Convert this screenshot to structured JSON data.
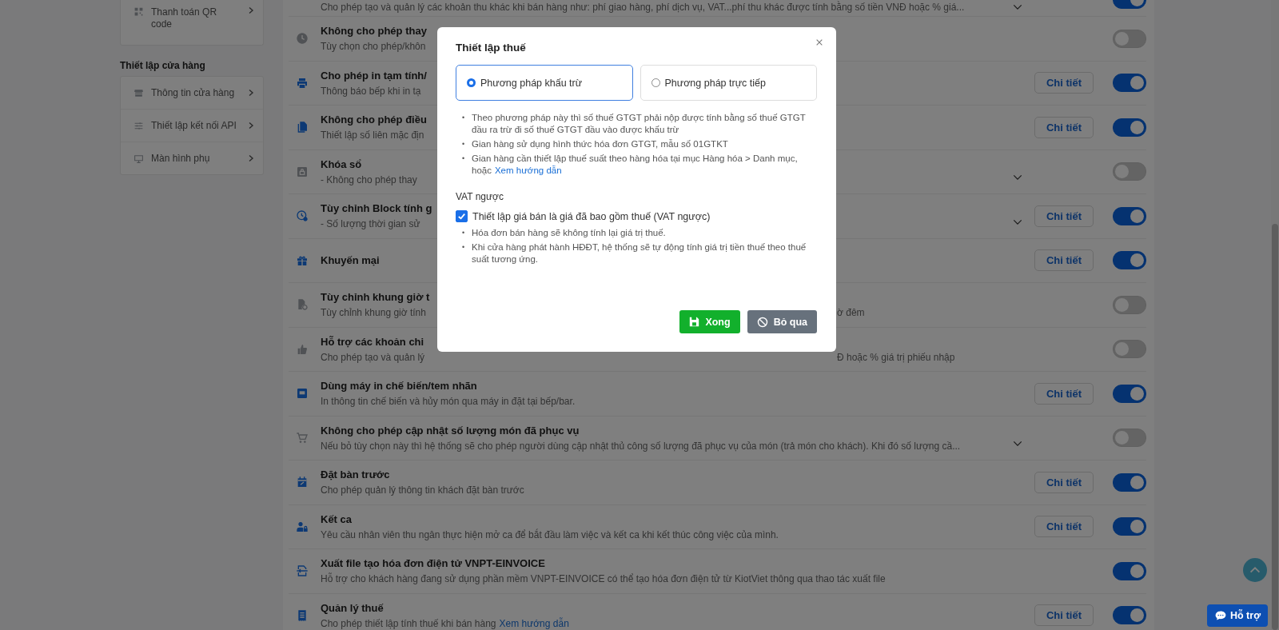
{
  "sidebar": {
    "cards": [
      {
        "items": [
          {
            "label": "Thanh toán QR code"
          }
        ]
      },
      {
        "heading": "Thiết lập cửa hàng",
        "items": [
          {
            "label": "Thông tin cửa hàng"
          },
          {
            "label": "Thiết lập kết nối API"
          },
          {
            "label": "Màn hình phụ"
          }
        ]
      }
    ]
  },
  "settings": [
    {
      "desc": "Cho phép tạo và quản lý các khoản thu khác khi bán hàng như: phí giao hàng, phí dịch vụ, VAT...phí thu khác được tính bằng số tiền VNĐ hoặc % giá...",
      "has_more": true,
      "on": true
    },
    {
      "title": "Không cho phép thay",
      "desc": "Tùy chọn cho phép/khôn",
      "on": false
    },
    {
      "title": "Cho phép in tạm tính/",
      "desc": "Thông báo bếp khi in tạ",
      "detail": "Chi tiết",
      "on": true
    },
    {
      "title": "Không cho phép điều",
      "desc": "Thiết lập số liên mặc địn",
      "detail": "Chi tiết",
      "on": true
    },
    {
      "title": "Khóa sổ",
      "desc": "- Không cho phép thay",
      "has_more": true,
      "on": false
    },
    {
      "title": "Tùy chỉnh Block tính g",
      "desc": "- Số lượng thời gian sử",
      "has_more": true,
      "detail": "Chi tiết",
      "on": true
    },
    {
      "title": "Khuyến mại",
      "detail": "Chi tiết",
      "on": true
    },
    {
      "title": "Tùy chỉnh khung giờ t",
      "desc": "Tùy chỉnh khung giờ tính",
      "desc_tail": "ờ đêm",
      "on": false
    },
    {
      "title": "Hỗ trợ các khoản chi",
      "desc": "Cho phép tạo và quản lý",
      "desc_tail": "Đ hoặc % giá trị phiếu nhập",
      "on": false
    },
    {
      "title": "Dùng máy in chế biến/tem nhãn",
      "desc": "In thông tin chế biến và hủy món qua máy in đặt tại bếp/bar.",
      "detail": "Chi tiết",
      "on": true
    },
    {
      "title": "Không cho phép cập nhật số lượng món đã phục vụ",
      "desc": "Nếu bỏ tùy chọn này thì hệ thống sẽ cho phép người dùng cập nhật thủ công số lượng đã phục vụ của món (trả món cho khách). Khi đó số lượng cầ...",
      "has_more": true,
      "on": false
    },
    {
      "title": "Đặt bàn trước",
      "desc": "Cho phép quản lý thông tin khách đặt bàn trước",
      "detail": "Chi tiết",
      "on": true
    },
    {
      "title": "Kết ca",
      "desc": "Yêu cầu nhân viên thu ngân thực hiện mở ca để bắt đầu làm việc và kết ca khi kết thúc công việc của mình.",
      "detail": "Chi tiết",
      "on": true
    },
    {
      "title": "Xuất file tạo hóa đơn điện tử VNPT-EINVOICE",
      "desc": "Hỗ trợ cho khách hàng đang sử dụng phần mềm VNPT-EINVOICE có thể tạo hóa đơn điện tử từ KiotViet thông qua thao tác xuất file",
      "on": true
    },
    {
      "title": "Quản lý thuế",
      "desc": "Cho phép thiết lập tính thuế khi bán hàng",
      "desc_link": "Xem hướng dẫn",
      "detail": "Chi tiết",
      "on": true
    }
  ],
  "modal": {
    "title": "Thiết lập thuế",
    "options": [
      {
        "label": "Phương pháp khấu trừ",
        "selected": true
      },
      {
        "label": "Phương pháp trực tiếp",
        "selected": false
      }
    ],
    "bullet": "•",
    "notes": [
      {
        "text": "Theo phương pháp này thì số thuế GTGT phải nộp được tính bằng số thuế GTGT đầu ra trừ đi số thuế GTGT đầu vào được khấu trừ"
      },
      {
        "text": "Gian hàng sử dụng hình thức hóa đơn GTGT, mẫu số 01GTKT"
      },
      {
        "text": "Gian hàng cần thiết lập thuế suất theo hàng hóa tại mục Hàng hóa > Danh mục, hoặc",
        "link": "Xem hướng dẫn"
      }
    ],
    "vat_heading": "VAT ngược",
    "vat_checkbox": {
      "label": "Thiết lập giá bán là giá đã bao gồm thuế (VAT ngược)",
      "checked": true
    },
    "vat_notes": [
      "Hóa đơn bán hàng sẽ không tính lại giá trị thuế.",
      "Khi cửa hàng phát hành HĐĐT, hệ thống sẽ tự động tính giá trị tiền thuế theo thuế suất tương ứng."
    ],
    "buttons": [
      {
        "kind": "primary",
        "label": "Xong"
      },
      {
        "kind": "secondary",
        "label": "Bỏ qua"
      }
    ]
  },
  "support_button": "Hỗ trợ"
}
